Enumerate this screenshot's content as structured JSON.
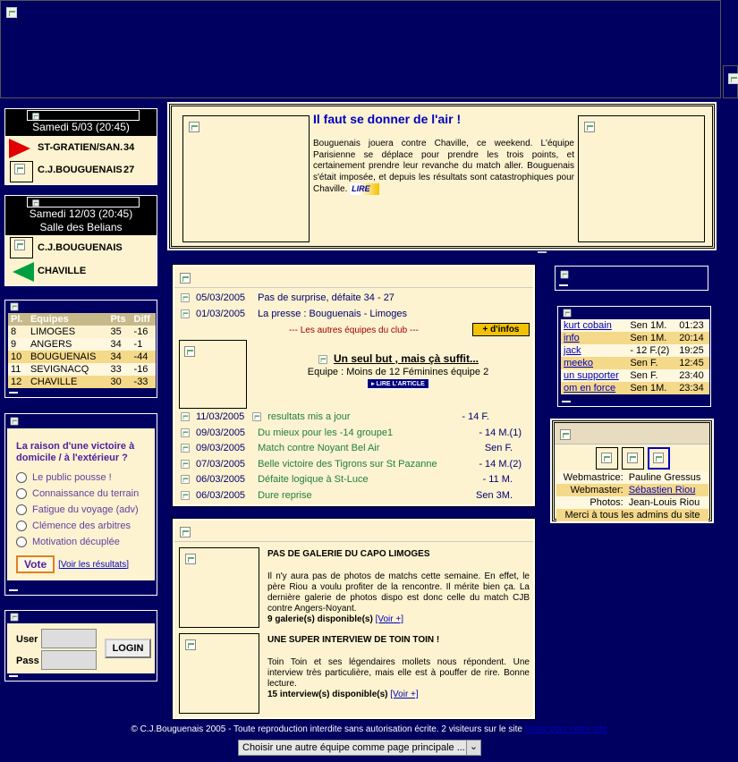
{
  "banner": {
    "icon": "broken-image-icon"
  },
  "match1": {
    "date": "Samedi 5/03 (20:45)",
    "team1": "ST-GRATIEN/SAN.",
    "score1": "34",
    "team2": "C.J.BOUGUENAIS",
    "score2": "27"
  },
  "match2": {
    "date": "Samedi 12/03 (20:45)",
    "venue": "Salle des Belians",
    "team1": "C.J.BOUGUENAIS",
    "team2": "CHAVILLE"
  },
  "standings": {
    "headers": [
      "Pl.",
      "Equipes",
      "Pts",
      "Diff"
    ],
    "rows": [
      {
        "pl": "8",
        "team": "LIMOGES",
        "pts": "35",
        "diff": "-16"
      },
      {
        "pl": "9",
        "team": "ANGERS",
        "pts": "34",
        "diff": "-1"
      },
      {
        "pl": "10",
        "team": "BOUGUENAIS",
        "pts": "34",
        "diff": "-44"
      },
      {
        "pl": "11",
        "team": "SEVIGNACQ",
        "pts": "33",
        "diff": "-16"
      },
      {
        "pl": "12",
        "team": "CHAVILLE",
        "pts": "30",
        "diff": "-33"
      }
    ]
  },
  "poll": {
    "question": "La raison d'une victoire à domicile / à l'extérieur ?",
    "options": [
      "Le public pousse !",
      "Connaissance du terrain",
      "Fatigue du voyage (adv)",
      "Clémence des arbitres",
      "Motivation décuplée"
    ],
    "vote_label": "Vote",
    "results_label": "[Voir les résultats]"
  },
  "login": {
    "user_label": "User",
    "pass_label": "Pass",
    "button": "LOGIN"
  },
  "headline": {
    "title": "Il faut se donner de l'air !",
    "body": "Bouguenais jouera contre Chaville, ce weekend. L'équipe Parisienne se déplace pour prendre les trois points, et certainement prendre leur revanche du match aller. Bouguenais s'était imposée, et depuis les résultats sont catastrophiques pour Chaville.",
    "lire": "LIRE"
  },
  "news": {
    "top": [
      {
        "date": "05/03/2005",
        "title": "Pas de surprise, défaite 34 - 27"
      },
      {
        "date": "01/03/2005",
        "title": "La presse : Bouguenais - Limoges"
      }
    ],
    "others_label": "--- Les autres équipes du club ---",
    "more_button": "+ d'infos",
    "featured_title": "Un seul but , mais çà suffit...",
    "featured_team": "Equipe : Moins de 12 Féminines équipe 2",
    "featured_link": "LIRE L'ARTICLE",
    "list": [
      {
        "date": "11/03/2005",
        "title": "resultats mis a jour",
        "team": "- 14 F."
      },
      {
        "date": "09/03/2005",
        "title": "Du mieux pour les -14 groupe1",
        "team": "- 14 M.(1)"
      },
      {
        "date": "09/03/2005",
        "title": "Match contre Noyant Bel Air",
        "team": "Sen F."
      },
      {
        "date": "07/03/2005",
        "title": "Belle victoire des Tigrons sur St Pazanne",
        "team": "- 14 M.(2)"
      },
      {
        "date": "06/03/2005",
        "title": "Défaite logique à St-Luce",
        "team": "- 11 M."
      },
      {
        "date": "06/03/2005",
        "title": "Dure reprise",
        "team": "Sen 3M."
      }
    ]
  },
  "gallery": {
    "item1_title": "PAS DE GALERIE DU CAPO LIMOGES",
    "item1_body": "Il n'y aura pas de photos de matchs cette semaine. En effet, le père Riou a voulu profiter de la rencontre. Il mérite bien ça. La dernière galerie de photos dispo est donc celle du match CJB contre Angers-Noyant.",
    "item1_count": "9 galerie(s) disponible(s)",
    "item1_link": "[Voir +]",
    "item2_title": "UNE SUPER INTERVIEW DE TOIN TOIN !",
    "item2_body": "Toin Toin et ses légendaires mollets nous répondent. Une interview très particulière, mais elle est à pouffer de rire. Bonne lecture.",
    "item2_count": "15 interview(s) disponible(s)",
    "item2_link": "[Voir +]"
  },
  "online": {
    "rows": [
      {
        "user": "kurt cobain",
        "team": "Sen 1M.",
        "time": "01:23"
      },
      {
        "user": "info",
        "team": "Sen 1M.",
        "time": "20:14"
      },
      {
        "user": "jack",
        "team": "- 12 F.(2)",
        "time": "19:25"
      },
      {
        "user": "meeko",
        "team": "Sen F.",
        "time": "12:45"
      },
      {
        "user": "un supporter",
        "team": "Sen F.",
        "time": "23:40"
      },
      {
        "user": "om en force",
        "team": "Sen 1M.",
        "time": "23:34"
      }
    ]
  },
  "admins": {
    "webmastrice_label": "Webmastrice:",
    "webmastrice": "Pauline Gressus",
    "webmaster_label": "Webmaster:",
    "webmaster": "Sébastien Riou",
    "photos_label": "Photos:",
    "photos": "Jean-Louis Riou",
    "thanks": "Merci à tous les admins du site"
  },
  "footer": {
    "text": "© C.J.Bouguenais 2005 - Toute reproduction interdite sans autorisation écrite. 2 visiteurs sur le site",
    "link": "Votez pour notre site",
    "select": "Choisir une autre équipe comme page principale ..."
  }
}
